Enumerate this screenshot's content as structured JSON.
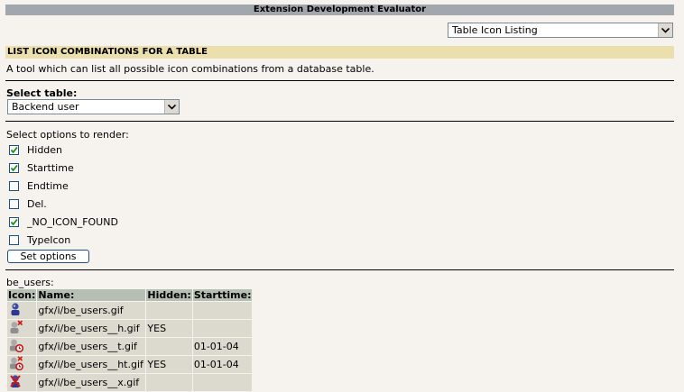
{
  "window": {
    "title": "Extension Development Evaluator"
  },
  "tool_select": {
    "value": "Table Icon Listing"
  },
  "section": {
    "header": "LIST ICON COMBINATIONS FOR A TABLE",
    "description": "A tool which can list all possible icon combinations from a database table."
  },
  "table_select": {
    "label": "Select table:",
    "value": "Backend user"
  },
  "options": {
    "label": "Select options to render:",
    "items": [
      {
        "label": "Hidden",
        "checked": true
      },
      {
        "label": "Starttime",
        "checked": true
      },
      {
        "label": "Endtime",
        "checked": false
      },
      {
        "label": "Del.",
        "checked": false
      },
      {
        "label": "_NO_ICON_FOUND",
        "checked": true
      },
      {
        "label": "TypeIcon",
        "checked": false
      }
    ],
    "button": "Set options"
  },
  "results": {
    "table_name": "be_users:",
    "headers": {
      "icon": "Icon:",
      "name": "Name:",
      "hidden": "Hidden:",
      "starttime": "Starttime:"
    },
    "rows": [
      {
        "icon": "user-icon",
        "name": "gfx/i/be_users.gif",
        "hidden": "",
        "starttime": ""
      },
      {
        "icon": "user-hidden-icon",
        "name": "gfx/i/be_users__h.gif",
        "hidden": "YES",
        "starttime": ""
      },
      {
        "icon": "user-timed-icon",
        "name": "gfx/i/be_users__t.gif",
        "hidden": "",
        "starttime": "01-01-04"
      },
      {
        "icon": "user-hidden-timed-icon",
        "name": "gfx/i/be_users__ht.gif",
        "hidden": "YES",
        "starttime": "01-01-04"
      },
      {
        "icon": "user-deleted-icon",
        "name": "gfx/i/be_users__x.gif",
        "hidden": "",
        "starttime": ""
      }
    ]
  }
}
